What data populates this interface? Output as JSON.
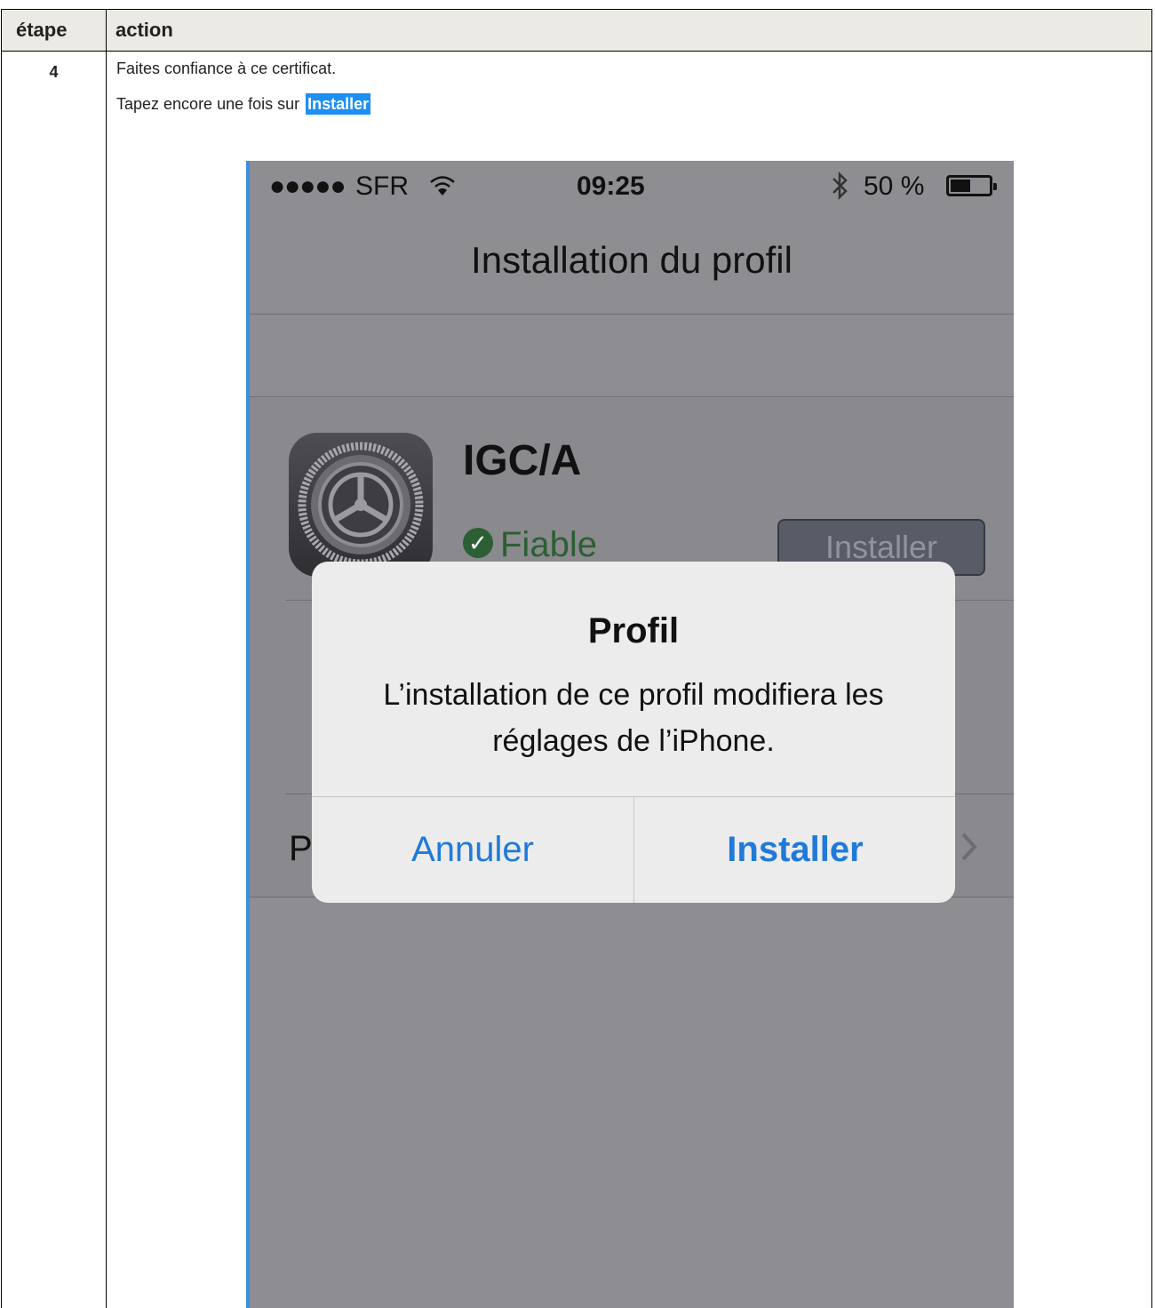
{
  "table": {
    "header": {
      "step": "étape",
      "action": "action"
    },
    "row": {
      "step": "4",
      "line1": "Faites confiance à ce certificat.",
      "line2_prefix": "Tapez encore une fois sur",
      "line2_highlight": "Installer"
    }
  },
  "phone": {
    "status": {
      "signal": "●●●●●",
      "carrier": "SFR",
      "time": "09:25",
      "battery": "50 %",
      "battery_level": 0.5
    },
    "nav_title": "Installation du profil",
    "profile": {
      "name": "IGC/A",
      "trusted_label": "Fiable",
      "install_button": "Installer",
      "row_letter": "P"
    },
    "alert": {
      "title": "Profil",
      "message": "L’installation de ce profil modifiera les réglages de l’iPhone.",
      "cancel": "Annuler",
      "confirm": "Installer"
    }
  },
  "colors": {
    "highlight": "#1d8ff5",
    "header_bg": "#ebeae4",
    "ios_blue": "#1f7ad9",
    "trusted_green": "#2c5f33"
  }
}
